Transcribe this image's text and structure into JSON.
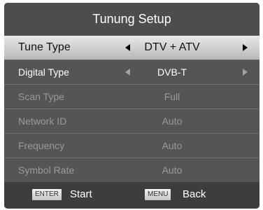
{
  "title": "Tunung Setup",
  "rows": [
    {
      "label": "Tune Type",
      "value": "DTV + ATV"
    },
    {
      "label": "Digital Type",
      "value": "DVB-T"
    },
    {
      "label": "Scan Type",
      "value": "Full"
    },
    {
      "label": "Network ID",
      "value": "Auto"
    },
    {
      "label": "Frequency",
      "value": "Auto"
    },
    {
      "label": "Symbol Rate",
      "value": "Auto"
    }
  ],
  "footer": {
    "enter_key": "ENTER",
    "enter_label": "Start",
    "menu_key": "MENU",
    "menu_label": "Back"
  },
  "colors": {
    "panel": "#555555",
    "highlight": "#d6d6d6",
    "active_text": "#ffffff",
    "disabled_text": "#9a9a9a"
  }
}
